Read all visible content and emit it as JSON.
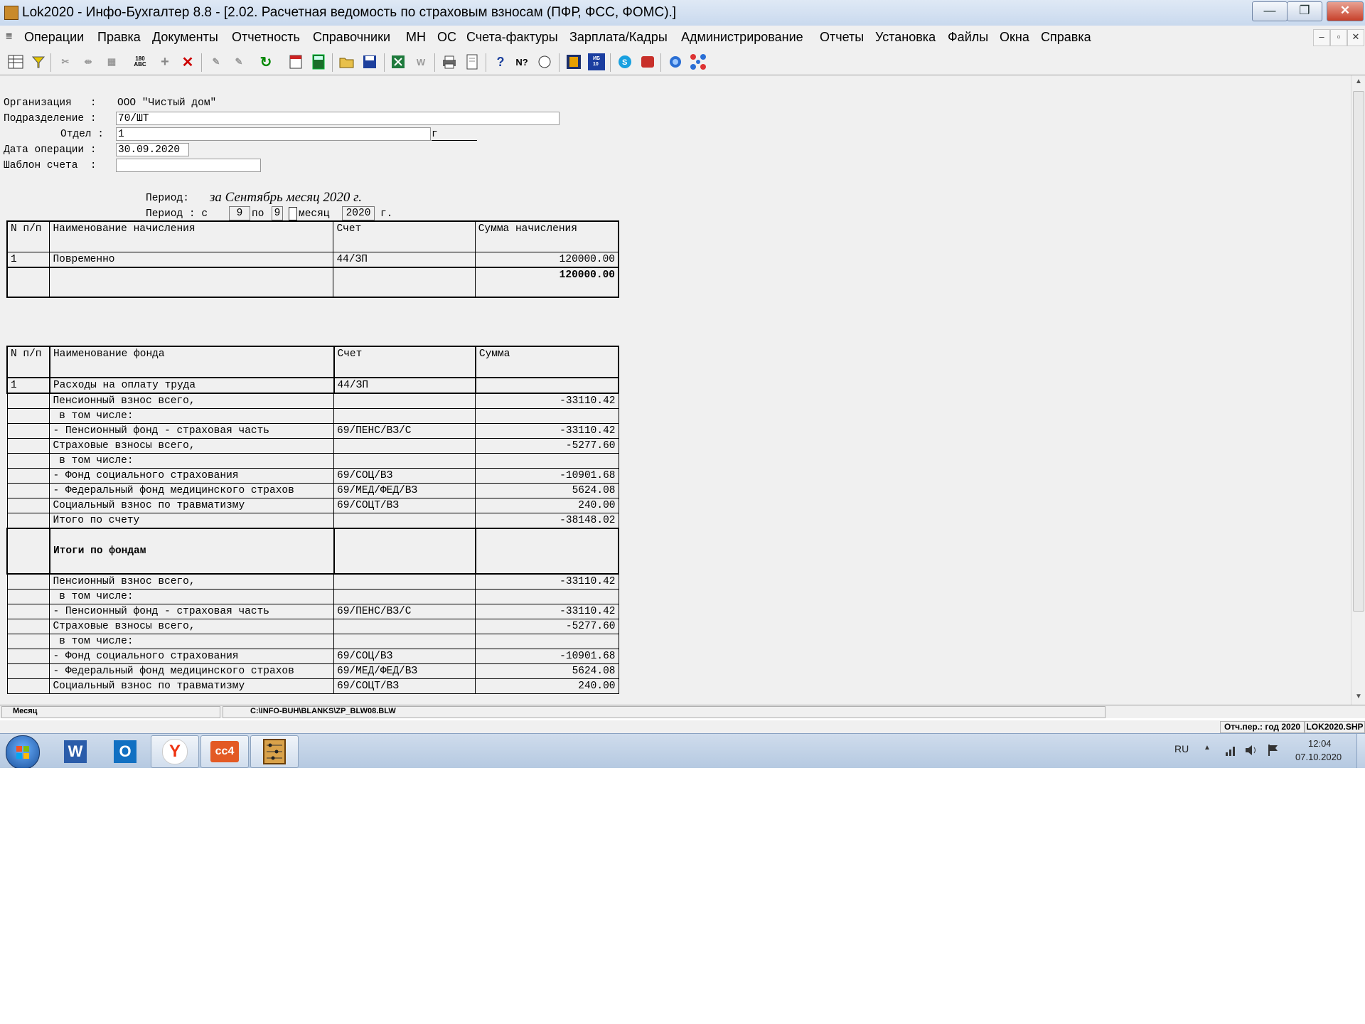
{
  "window": {
    "title": "Lok2020 - Инфо-Бухгалтер 8.8 - [2.02.  Расчетная ведомость по страховым взносам (ПФР, ФСС, ФОМС).]",
    "btn_min": "—",
    "btn_restore": "❐",
    "btn_close": "✕"
  },
  "menu": {
    "doc_icon": "≡",
    "items": [
      "Операции",
      "Правка",
      "Документы",
      "Отчетность",
      "Справочники",
      "МН",
      "ОС",
      "Счета-фактуры",
      "Зарплата/Кадры",
      "Администрирование",
      "Отчеты",
      "Установка",
      "Файлы",
      "Окна",
      "Справка"
    ],
    "mdi_min": "–",
    "mdi_restore": "▫",
    "mdi_close": "✕"
  },
  "toolbar": {
    "icons": [
      "table-icon",
      "filter-icon",
      "cut-icon",
      "move-icon",
      "paste-icon",
      "abc-icon",
      "add-icon",
      "delete-icon",
      "tool1-icon",
      "tool2-icon",
      "refresh-icon",
      "calendar-icon",
      "calculator-icon",
      "open-icon",
      "save-icon",
      "excel-icon",
      "word-icon",
      "print-icon",
      "preview-icon",
      "help-icon",
      "context-help-icon",
      "navigate-icon",
      "info-icon",
      "ib10-icon",
      "skype-icon",
      "remote-icon",
      "web-icon",
      "network-icon"
    ],
    "abc_text": "180\nABC",
    "ib10_text": "ИБ\n10"
  },
  "form": {
    "org_label": "Организация   :",
    "org_value": "ООО \"Чистый дом\"",
    "subdiv_label": "Подразделение :",
    "subdiv_value": "70/ШТ",
    "dept_label": "Отдел :",
    "dept_value": "1",
    "dept_suffix": "г",
    "date_label": "Дата операции :",
    "date_value": "30.09.2020",
    "template_label": "Шаблон счета  :",
    "template_value": ""
  },
  "period": {
    "label1": "Период:",
    "text1": "за Сентябрь месяц 2020 г.",
    "label2": "Период : с",
    "from": "9",
    "to_label": "по",
    "to": "9",
    "month_label": "месяц",
    "year": "2020",
    "year_suffix": "г."
  },
  "accruals": {
    "headers": [
      "N п/п",
      "Наименование начисления",
      "Счет",
      "Сумма начисления"
    ],
    "rows": [
      [
        "1",
        "Повременно",
        "44/ЗП",
        "120000.00"
      ]
    ],
    "total": "120000.00"
  },
  "funds": {
    "headers": [
      "N п/п",
      "Наименование фонда",
      "Счет",
      "Сумма"
    ],
    "rows": [
      [
        "1",
        "Расходы на оплату труда",
        "44/ЗП",
        ""
      ],
      [
        "",
        "Пенсионный взнос всего,",
        "",
        "-33110.42"
      ],
      [
        "",
        " в том числе:",
        "",
        ""
      ],
      [
        "",
        "- Пенсионный фонд - страховая часть",
        "69/ПЕНС/ВЗ/С",
        "-33110.42"
      ],
      [
        "",
        "Страховые взносы всего,",
        "",
        "-5277.60"
      ],
      [
        "",
        " в том числе:",
        "",
        ""
      ],
      [
        "",
        "- Фонд социального страхования",
        "69/СОЦ/ВЗ",
        "-10901.68"
      ],
      [
        "",
        "- Федеральный фонд медицинского страхов",
        "69/МЕД/ФЕД/ВЗ",
        "5624.08"
      ],
      [
        "",
        "Социальный взнос по травматизму",
        "69/СОЦТ/ВЗ",
        "240.00"
      ],
      [
        "",
        "Итого по счету",
        "",
        "-38148.02"
      ]
    ],
    "summary_label": "Итоги по фондам",
    "summary_rows": [
      [
        "",
        "Пенсионный взнос всего,",
        "",
        "-33110.42"
      ],
      [
        "",
        " в том числе:",
        "",
        ""
      ],
      [
        "",
        "- Пенсионный фонд - страховая часть",
        "69/ПЕНС/ВЗ/С",
        "-33110.42"
      ],
      [
        "",
        "Страховые взносы всего,",
        "",
        "-5277.60"
      ],
      [
        "",
        " в том числе:",
        "",
        ""
      ],
      [
        "",
        "- Фонд социального страхования",
        "69/СОЦ/ВЗ",
        "-10901.68"
      ],
      [
        "",
        "- Федеральный фонд медицинского страхов",
        "69/МЕД/ФЕД/ВЗ",
        "5624.08"
      ],
      [
        "",
        "Социальный взнос по травматизму",
        "69/СОЦТ/ВЗ",
        "240.00"
      ]
    ]
  },
  "statusbar": {
    "mode": "Месяц",
    "path": "C:\\INFO-BUH\\BLANKS\\ZP_BLW08.BLW",
    "period": "Отч.пер.: год 2020",
    "file": "LOK2020.SHP"
  },
  "taskbar": {
    "apps": [
      "Word",
      "Outlook",
      "Yandex",
      "CC4",
      "Info-Buh"
    ],
    "word_glyph": "W",
    "outlook_glyph": "O",
    "yandex_glyph": "Y",
    "cc4_glyph": "cc4",
    "lang": "RU",
    "tray_up": "▲",
    "time": "12:04",
    "date": "07.10.2020"
  }
}
